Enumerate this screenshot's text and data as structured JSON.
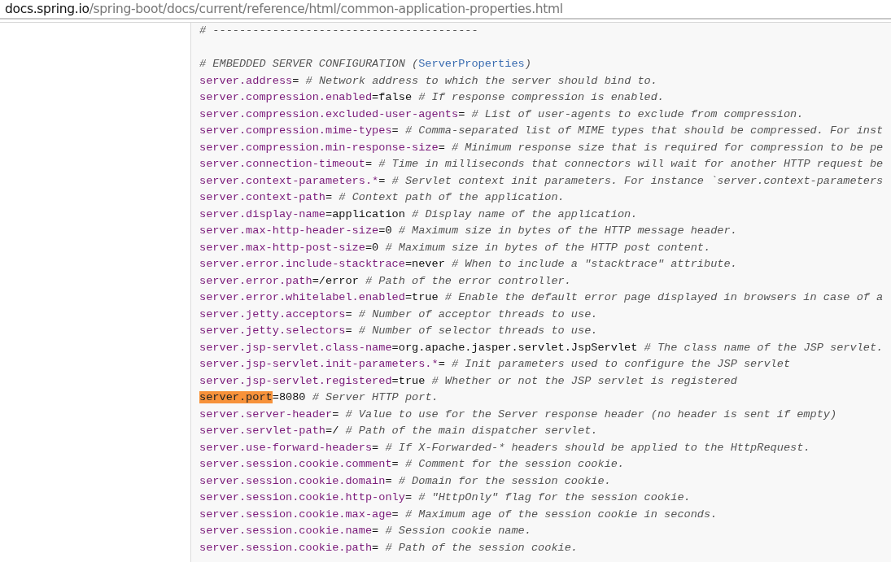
{
  "address_bar": {
    "host": "docs.spring.io",
    "path": "/spring-boot/docs/current/reference/html/common-application-properties.html"
  },
  "code_lines": [
    {
      "kind": "comment",
      "text": "# ----------------------------------------"
    },
    {
      "kind": "blank"
    },
    {
      "kind": "heading",
      "text": "# EMBEDDED SERVER CONFIGURATION (",
      "link": "ServerProperties",
      "after": ")"
    },
    {
      "kind": "property",
      "key": "server.address",
      "value": "=",
      "comment": "# Network address to which the server should bind to.",
      "highlighted": false
    },
    {
      "kind": "property",
      "key": "server.compression.enabled",
      "value": "=false",
      "comment": "# If response compression is enabled.",
      "highlighted": false
    },
    {
      "kind": "property",
      "key": "server.compression.excluded-user-agents",
      "value": "=",
      "comment": "# List of user-agents to exclude from compression.",
      "highlighted": false
    },
    {
      "kind": "property",
      "key": "server.compression.mime-types",
      "value": "=",
      "comment": "# Comma-separated list of MIME types that should be compressed. For inst",
      "highlighted": false
    },
    {
      "kind": "property",
      "key": "server.compression.min-response-size",
      "value": "=",
      "comment": "# Minimum response size that is required for compression to be pe",
      "highlighted": false
    },
    {
      "kind": "property",
      "key": "server.connection-timeout",
      "value": "=",
      "comment": "# Time in milliseconds that connectors will wait for another HTTP request be",
      "highlighted": false
    },
    {
      "kind": "property",
      "key": "server.context-parameters.*",
      "value": "=",
      "comment": "# Servlet context init parameters. For instance `server.context-parameters",
      "highlighted": false
    },
    {
      "kind": "property",
      "key": "server.context-path",
      "value": "=",
      "comment": "# Context path of the application.",
      "highlighted": false
    },
    {
      "kind": "property",
      "key": "server.display-name",
      "value": "=application",
      "comment": "# Display name of the application.",
      "highlighted": false
    },
    {
      "kind": "property",
      "key": "server.max-http-header-size",
      "value": "=0",
      "comment": "# Maximum size in bytes of the HTTP message header.",
      "highlighted": false
    },
    {
      "kind": "property",
      "key": "server.max-http-post-size",
      "value": "=0",
      "comment": "# Maximum size in bytes of the HTTP post content.",
      "highlighted": false
    },
    {
      "kind": "property",
      "key": "server.error.include-stacktrace",
      "value": "=never",
      "comment": "# When to include a \"stacktrace\" attribute.",
      "highlighted": false
    },
    {
      "kind": "property",
      "key": "server.error.path",
      "value": "=/error",
      "comment": "# Path of the error controller.",
      "highlighted": false
    },
    {
      "kind": "property",
      "key": "server.error.whitelabel.enabled",
      "value": "=true",
      "comment": "# Enable the default error page displayed in browsers in case of a",
      "highlighted": false
    },
    {
      "kind": "property",
      "key": "server.jetty.acceptors",
      "value": "=",
      "comment": "# Number of acceptor threads to use.",
      "highlighted": false
    },
    {
      "kind": "property",
      "key": "server.jetty.selectors",
      "value": "=",
      "comment": "# Number of selector threads to use.",
      "highlighted": false
    },
    {
      "kind": "property",
      "key": "server.jsp-servlet.class-name",
      "value": "=org.apache.jasper.servlet.JspServlet",
      "comment": "# The class name of the JSP servlet.",
      "highlighted": false
    },
    {
      "kind": "property",
      "key": "server.jsp-servlet.init-parameters.*",
      "value": "=",
      "comment": "# Init parameters used to configure the JSP servlet",
      "highlighted": false
    },
    {
      "kind": "property",
      "key": "server.jsp-servlet.registered",
      "value": "=true",
      "comment": "# Whether or not the JSP servlet is registered",
      "highlighted": false
    },
    {
      "kind": "property",
      "key": "server.port",
      "value": "=8080",
      "comment": "# Server HTTP port.",
      "highlighted": true
    },
    {
      "kind": "property",
      "key": "server.server-header",
      "value": "=",
      "comment": "# Value to use for the Server response header (no header is sent if empty)",
      "highlighted": false
    },
    {
      "kind": "property",
      "key": "server.servlet-path",
      "value": "=/",
      "comment": "# Path of the main dispatcher servlet.",
      "highlighted": false
    },
    {
      "kind": "property",
      "key": "server.use-forward-headers",
      "value": "=",
      "comment": "# If X-Forwarded-* headers should be applied to the HttpRequest.",
      "highlighted": false
    },
    {
      "kind": "property",
      "key": "server.session.cookie.comment",
      "value": "=",
      "comment": "# Comment for the session cookie.",
      "highlighted": false
    },
    {
      "kind": "property",
      "key": "server.session.cookie.domain",
      "value": "=",
      "comment": "# Domain for the session cookie.",
      "highlighted": false
    },
    {
      "kind": "property",
      "key": "server.session.cookie.http-only",
      "value": "=",
      "comment": "# \"HttpOnly\" flag for the session cookie.",
      "highlighted": false
    },
    {
      "kind": "property",
      "key": "server.session.cookie.max-age",
      "value": "=",
      "comment": "# Maximum age of the session cookie in seconds.",
      "highlighted": false
    },
    {
      "kind": "property",
      "key": "server.session.cookie.name",
      "value": "=",
      "comment": "# Session cookie name.",
      "highlighted": false
    },
    {
      "kind": "property",
      "key": "server.session.cookie.path",
      "value": "=",
      "comment": "# Path of the session cookie.",
      "highlighted": false
    }
  ]
}
